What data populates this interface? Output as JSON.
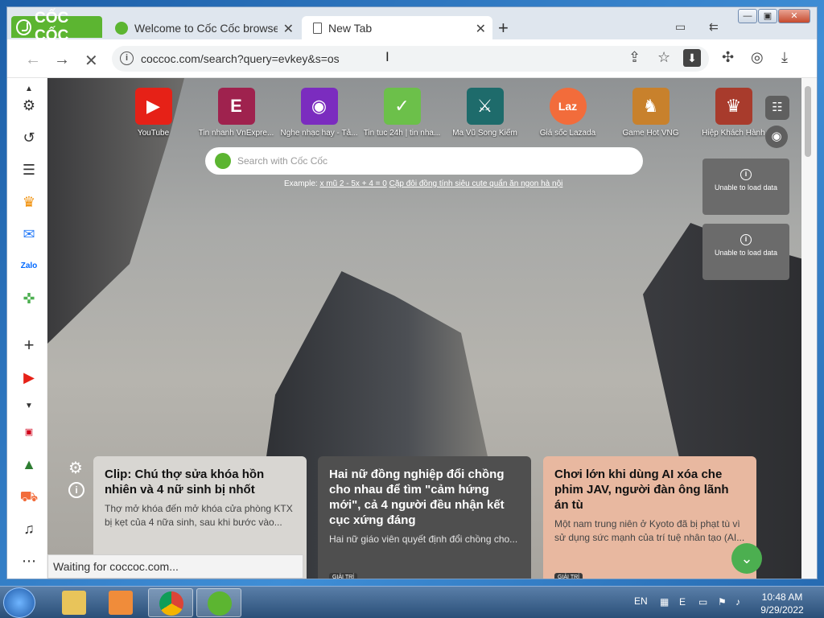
{
  "browser": {
    "logo_text": "CỐC CỐC",
    "tabs": [
      {
        "title": "Welcome to Cốc Cốc browse",
        "close": "✕"
      },
      {
        "title": "New Tab",
        "close": "✕"
      }
    ],
    "new_tab": "+",
    "window_controls": {
      "minimize": "—",
      "maximize": "▣",
      "close": "✕"
    },
    "address": "coccoc.com/search?query=evkey&s=os",
    "status_text": "Waiting for coccoc.com..."
  },
  "quick_links": [
    {
      "label": "YouTube",
      "color": "#e62117",
      "glyph": "▶"
    },
    {
      "label": "Tin nhanh VnExpre...",
      "color": "#9f224e",
      "glyph": "E"
    },
    {
      "label": "Nghe nhạc hay - Tả...",
      "color": "#7b2cbf",
      "glyph": "◉"
    },
    {
      "label": "Tin tuc 24h | tin nha...",
      "color": "#6cc04a",
      "glyph": "✓"
    },
    {
      "label": "Ma Vũ Song Kiếm",
      "color": "#1e6b6b",
      "glyph": "⚔"
    },
    {
      "label": "Giá sốc Lazada",
      "color": "#f26c3b",
      "glyph": "Laz"
    },
    {
      "label": "Game Hot VNG",
      "color": "#c8812c",
      "glyph": "♞"
    },
    {
      "label": "Hiệp Khách Hành",
      "color": "#a83b2c",
      "glyph": "♛"
    }
  ],
  "search": {
    "placeholder": "Search with Cốc Cốc",
    "example_label": "Example:",
    "example_link1": "x mũ 2 - 5x + 4 = 0",
    "example_link2": "Cặp đôi đồng tính siêu cute quẩn ăn ngon hà nội"
  },
  "widgets": [
    {
      "text": "Unable to load data"
    },
    {
      "text": "Unable to load data"
    }
  ],
  "news": [
    {
      "title": "Clip: Chú thợ sửa khóa hồn nhiên và 4 nữ sinh bị nhốt",
      "desc": "Thợ mở khóa đến mở khóa cửa phòng KTX bị kẹt của 4 nữa sinh, sau khi bước vào..."
    },
    {
      "title": "Hai nữ đồng nghiệp đổi chồng cho nhau để tìm \"cảm hứng mới\", cả 4 người đều nhận kết cục xứng đáng",
      "desc": "Hai nữ giáo viên quyết định đổi chồng cho...",
      "chip": "GIẢI TRÍ"
    },
    {
      "title": "Chơi lớn khi dùng AI xóa che phim JAV, người đàn ông lãnh án tù",
      "desc": "Một nam trung niên ở Kyoto đã bị phạt tù vì sử dụng sức mạnh của trí tuệ nhân tạo (AI...",
      "chip": "GIẢI TRÍ"
    }
  ],
  "taskbar": {
    "lang": "EN",
    "time": "10:48 AM",
    "date": "9/29/2022"
  }
}
